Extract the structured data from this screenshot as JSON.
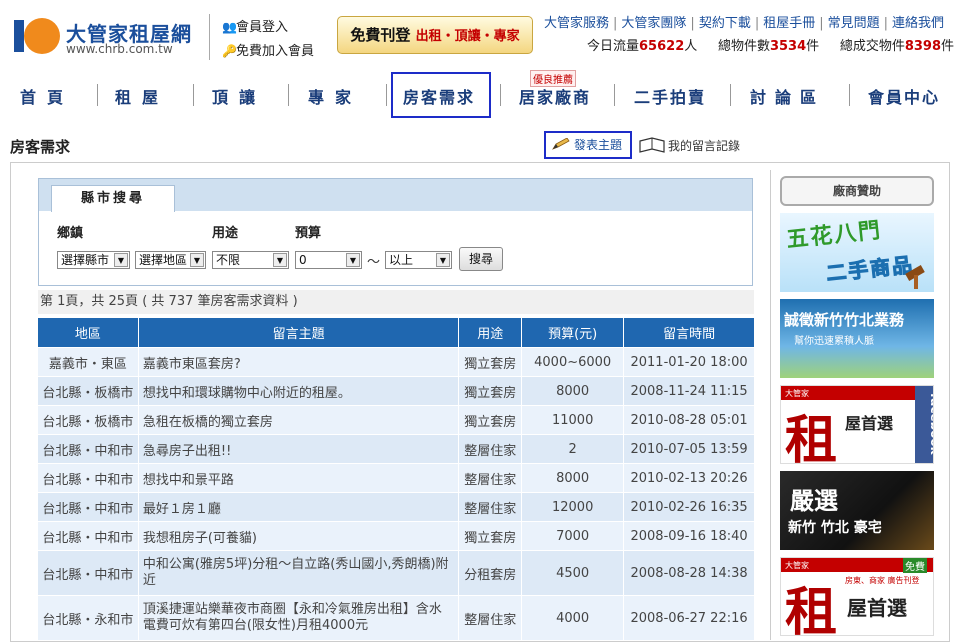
{
  "header": {
    "logo_title": "大管家租屋網",
    "logo_url": "www.chrb.com.tw",
    "member_login": "會員登入",
    "member_join": "免費加入會員",
    "promo_main": "免費刊登",
    "promo_sub": "出租・頂讓・專家",
    "top_links": [
      "大管家服務",
      "大管家團隊",
      "契約下載",
      "租屋手冊",
      "常見問題",
      "連絡我們"
    ],
    "stats": {
      "today_label": "今日流量",
      "today_value": "65622",
      "today_unit": "人",
      "total_label": "總物件數",
      "total_value": "3534",
      "total_unit": "件",
      "deal_label": "總成交物件",
      "deal_value": "8398",
      "deal_unit": "件"
    }
  },
  "nav": {
    "items": [
      "首頁",
      "租屋",
      "頂讓",
      "專家",
      "房客需求",
      "居家廠商",
      "二手拍賣",
      "討論區",
      "會員中心"
    ],
    "active": "房客需求",
    "badge": "優良推薦"
  },
  "page": {
    "title": "房客需求",
    "post_button": "發表主題",
    "my_messages": "我的留言記錄"
  },
  "search": {
    "tab": "縣市搜尋",
    "labels": {
      "town": "鄉鎮",
      "usage": "用途",
      "budget": "預算"
    },
    "county": "選擇縣市",
    "area": "選擇地區",
    "usage": "不限",
    "budget_min": "0",
    "tilde": "～",
    "budget_max": "以上",
    "button": "搜尋"
  },
  "pager": {
    "text": "第 1頁，共 25頁 ( 共 737 筆房客需求資料 )"
  },
  "table": {
    "headers": [
      "地區",
      "留言主題",
      "用途",
      "預算(元)",
      "留言時間"
    ],
    "rows": [
      [
        "嘉義市・東區",
        "嘉義市東區套房?",
        "獨立套房",
        "4000~6000",
        "2011-01-20 18:00"
      ],
      [
        "台北縣・板橋市",
        "想找中和環球購物中心附近的租屋。",
        "獨立套房",
        "8000",
        "2008-11-24 11:15"
      ],
      [
        "台北縣・板橋市",
        "急租在板橋的獨立套房",
        "獨立套房",
        "11000",
        "2010-08-28 05:01"
      ],
      [
        "台北縣・中和市",
        "急尋房子出租!!",
        "整層住家",
        "2",
        "2010-07-05 13:59"
      ],
      [
        "台北縣・中和市",
        "想找中和景平路",
        "整層住家",
        "8000",
        "2010-02-13 20:26"
      ],
      [
        "台北縣・中和市",
        "最好１房１廳",
        "整層住家",
        "12000",
        "2010-02-26 16:35"
      ],
      [
        "台北縣・中和市",
        "我想租房子(可養貓)",
        "獨立套房",
        "7000",
        "2008-09-16 18:40"
      ],
      [
        "台北縣・中和市",
        "中和公寓(雅房5坪)分租～自立路(秀山國小,秀朗橋)附近",
        "分租套房",
        "4500",
        "2008-08-28 14:38"
      ],
      [
        "台北縣・永和市",
        "頂溪捷運站樂華夜市商圈【永和冷氣雅房出租】含水電費可炊有第四台(限女性)月租4000元",
        "整層住家",
        "4000",
        "2008-06-27 22:16"
      ]
    ]
  },
  "sidebar": {
    "title": "廠商贊助",
    "ads": [
      {
        "line1": "五花八門",
        "line2": "二手商品"
      },
      {
        "line1": "誠徵新竹竹北業務",
        "line2": "幫你迅速累積人脈"
      },
      {
        "big": "租",
        "line1": "屋首選",
        "line2": "facebook",
        "brand": "大管家"
      },
      {
        "line1": "嚴選",
        "line2": "新竹 竹北 豪宅"
      },
      {
        "big": "租",
        "line1": "屋首選",
        "line2": "房東、商家 廣告刊登",
        "brand": "大管家",
        "tag": "免費"
      }
    ]
  },
  "colors": {
    "brand_blue": "#1b4f9c",
    "accent_red": "#c40000",
    "table_header": "#1f67b0",
    "active_border": "#1d2cc8"
  }
}
